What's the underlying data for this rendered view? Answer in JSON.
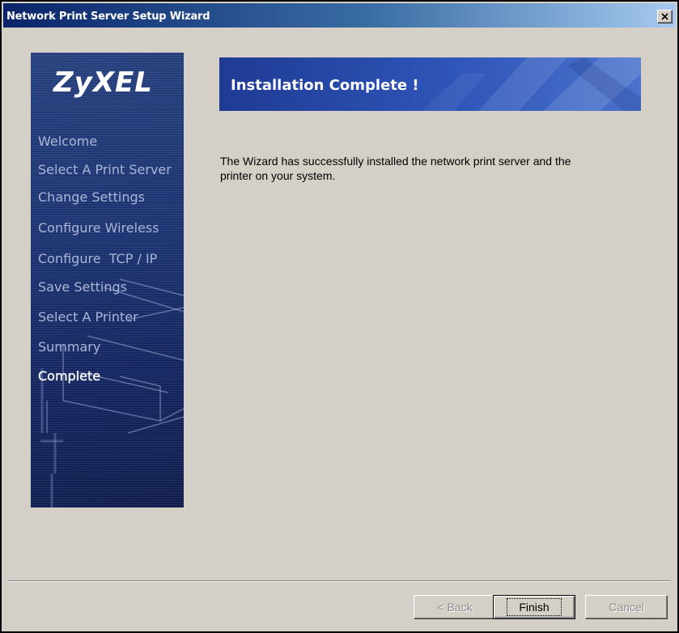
{
  "window": {
    "title": "Network Print Server Setup Wizard",
    "close_symbol": "×"
  },
  "sidebar": {
    "logo": "ZyXEL",
    "steps": [
      {
        "label": "Welcome",
        "active": false
      },
      {
        "label": "Select A Print Server",
        "active": false
      },
      {
        "label": "Change Settings",
        "active": false
      },
      {
        "label": "Configure Wireless",
        "active": false
      },
      {
        "label": "Configure  TCP / IP",
        "active": false
      },
      {
        "label": "Save Settings",
        "active": false
      },
      {
        "label": "Select A Printer",
        "active": false
      },
      {
        "label": "Summary",
        "active": false
      },
      {
        "label": "Complete",
        "active": true
      }
    ]
  },
  "banner": {
    "title": "Installation Complete !"
  },
  "content": {
    "message": "The Wizard has successfully installed the network print server and the printer on your system."
  },
  "buttons": {
    "back": "< Back",
    "finish": "Finish",
    "cancel": "Cancel"
  },
  "icons": {
    "close": "close-icon",
    "sidebar_art": "printer-illustration-icon"
  },
  "colors": {
    "titlebar_start": "#0a246a",
    "titlebar_end": "#a6caf0",
    "sidebar": "#1d3372",
    "banner": "#2e55b8",
    "dialog_bg": "#d4d0c8"
  }
}
